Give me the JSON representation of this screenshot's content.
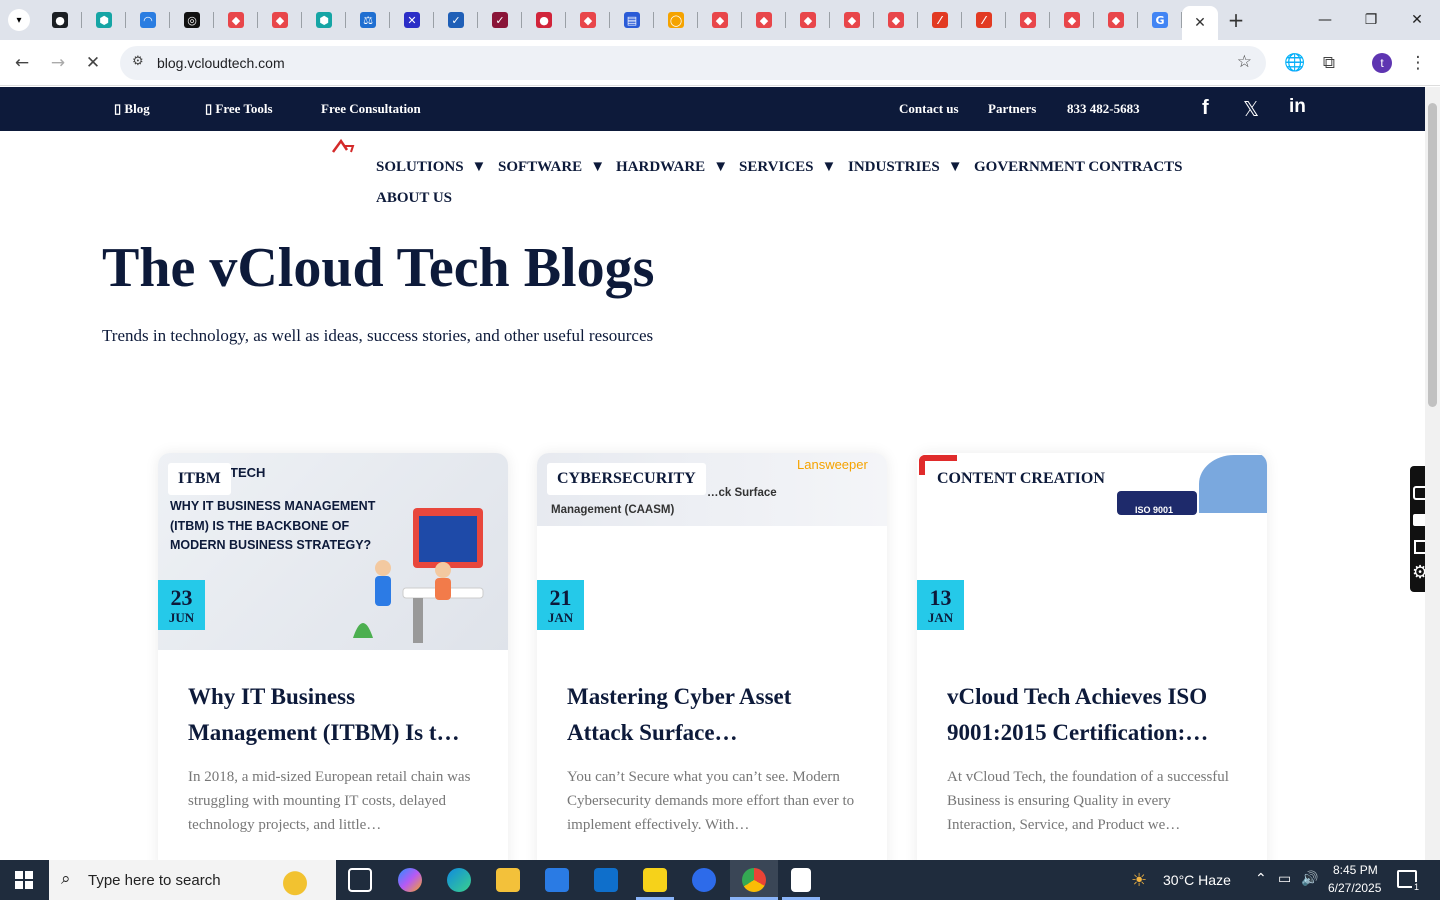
{
  "browser": {
    "tab_favicons": [
      {
        "name": "github-tab-icon",
        "color": "#1b1f23",
        "glyph": "●"
      },
      {
        "name": "tab-icon-2",
        "color": "#16a5a5",
        "glyph": "⬢"
      },
      {
        "name": "tab-icon-3",
        "color": "#2a7de1",
        "glyph": "◠"
      },
      {
        "name": "tab-icon-4",
        "color": "#111111",
        "glyph": "◎"
      },
      {
        "name": "tab-icon-5",
        "color": "#e8464a",
        "glyph": "◆"
      },
      {
        "name": "tab-icon-6",
        "color": "#e8464a",
        "glyph": "◆"
      },
      {
        "name": "tab-icon-7",
        "color": "#16a5a5",
        "glyph": "⬢"
      },
      {
        "name": "tab-icon-8",
        "color": "#1f6fd1",
        "glyph": "⚖"
      },
      {
        "name": "tab-icon-9",
        "color": "#2b2ec7",
        "glyph": "✕"
      },
      {
        "name": "tab-icon-10",
        "color": "#1f5fb7",
        "glyph": "✓"
      },
      {
        "name": "tab-icon-11",
        "color": "#8a1538",
        "glyph": "✓"
      },
      {
        "name": "tab-icon-12",
        "color": "#d1243a",
        "glyph": "●"
      },
      {
        "name": "tab-icon-13",
        "color": "#e8464a",
        "glyph": "◆"
      },
      {
        "name": "tab-icon-14",
        "color": "#2a5bd7",
        "glyph": "▤"
      },
      {
        "name": "tab-icon-15",
        "color": "#f5a300",
        "glyph": "◯"
      },
      {
        "name": "tab-icon-16",
        "color": "#e8464a",
        "glyph": "◆"
      },
      {
        "name": "tab-icon-17",
        "color": "#e8464a",
        "glyph": "◆"
      },
      {
        "name": "tab-icon-18",
        "color": "#e8464a",
        "glyph": "◆"
      },
      {
        "name": "tab-icon-19",
        "color": "#e8464a",
        "glyph": "◆"
      },
      {
        "name": "tab-icon-20",
        "color": "#e8464a",
        "glyph": "◆"
      },
      {
        "name": "tab-icon-21",
        "color": "#e23a22",
        "glyph": "⁄"
      },
      {
        "name": "tab-icon-22",
        "color": "#e23a22",
        "glyph": "⁄"
      },
      {
        "name": "tab-icon-23",
        "color": "#e8464a",
        "glyph": "◆"
      },
      {
        "name": "tab-icon-24",
        "color": "#e8464a",
        "glyph": "◆"
      },
      {
        "name": "tab-icon-25",
        "color": "#e8464a",
        "glyph": "◆"
      },
      {
        "name": "google-tab-icon",
        "color": "#4285f4",
        "glyph": "G"
      }
    ],
    "url": "blog.vcloudtech.com",
    "profile_initial": "t"
  },
  "topbar": {
    "blog": "Blog",
    "free_tools": "Free Tools",
    "free_consultation": "Free Consultation",
    "contact": "Contact us",
    "partners": "Partners",
    "phone": "833 482-5683"
  },
  "nav": {
    "solutions": "SOLUTIONS",
    "software": "SOFTWARE",
    "hardware": "HARDWARE",
    "services": "SERVICES",
    "industries": "INDUSTRIES",
    "government": "GOVERNMENT CONTRACTS",
    "about": "ABOUT US"
  },
  "hero": {
    "title": "The vCloud Tech Blogs",
    "subtitle": "Trends in technology, as well as ideas, success stories, and other useful resources"
  },
  "cards": [
    {
      "category": "ITBM",
      "day": "23",
      "month": "JUN",
      "title": "Why IT Business Management (ITBM) Is t…",
      "excerpt": "In 2018, a mid-sized European retail chain was struggling with mounting IT costs, delayed technology projects, and little…",
      "image_text": "WHY IT BUSINESS MANAGEMENT (ITBM) IS THE BACKBONE OF MODERN BUSINESS STRATEGY?",
      "image_logo": "TECH"
    },
    {
      "category": "CYBERSECURITY",
      "day": "21",
      "month": "JAN",
      "title": "Mastering Cyber Asset Attack Surface…",
      "excerpt": "You can’t Secure what you can’t see. Modern Cybersecurity demands more effort than ever to implement effectively. With…",
      "image_text": "…ck Surface",
      "image_text2": "Management (CAASM)",
      "image_logo": "Lansweeper"
    },
    {
      "category": "CONTENT CREATION",
      "day": "13",
      "month": "JAN",
      "title": "vCloud Tech Achieves ISO 9001:2015 Certification:…",
      "excerpt": "At vCloud Tech, the foundation of a successful Business is ensuring Quality in every Interaction, Service, and Product we…",
      "image_text": "ISO 9001"
    }
  ],
  "taskbar": {
    "search_placeholder": "Type here to search",
    "weather": "30°C  Haze",
    "time": "8:45 PM",
    "date": "6/27/2025",
    "notification_count": "1"
  },
  "colors": {
    "navy": "#0d1a3a",
    "cyan": "#25c9e9",
    "tab_strip": "#dfe3eb"
  }
}
